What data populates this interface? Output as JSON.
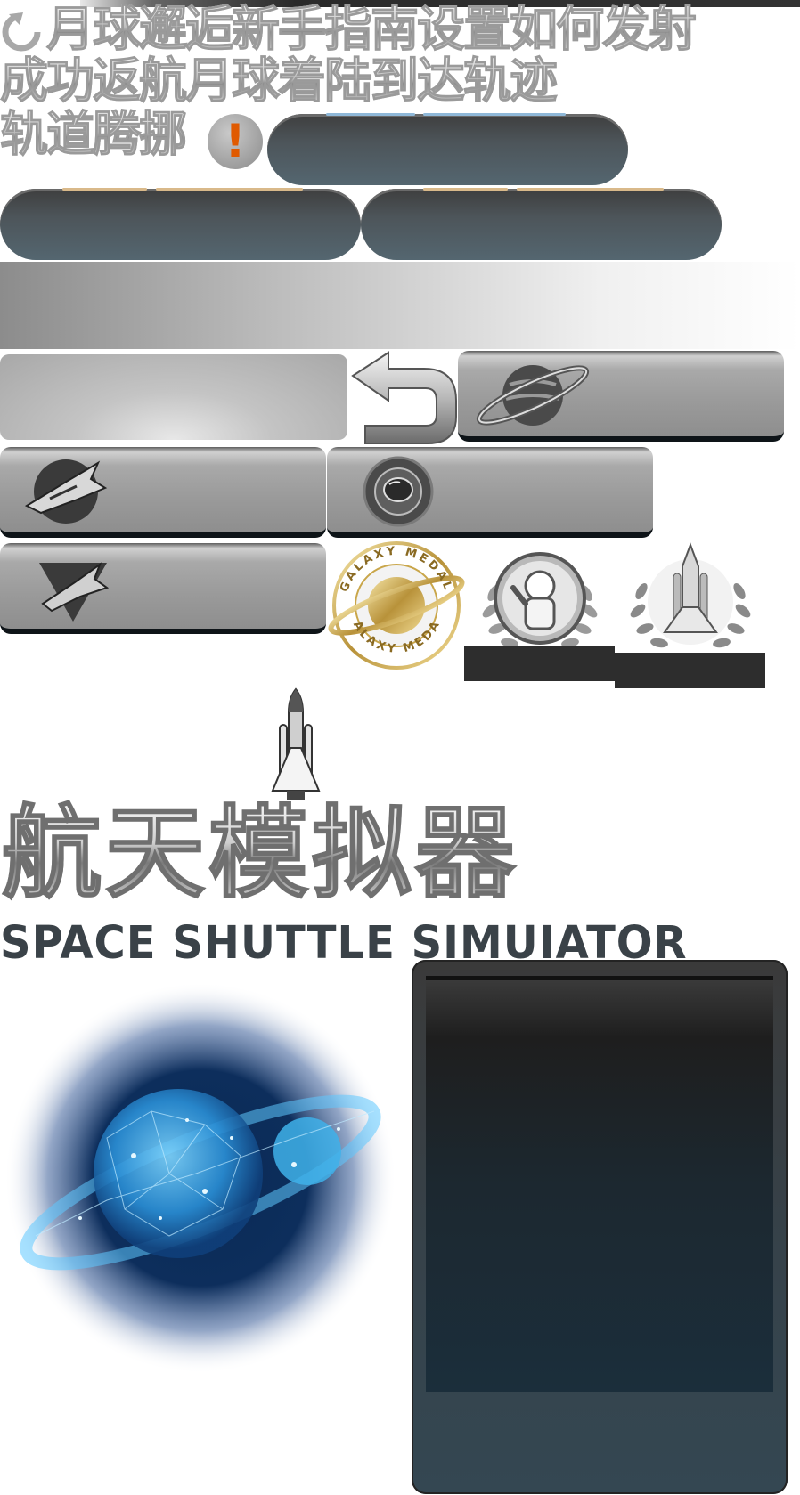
{
  "headline": {
    "line1": "月球邂逅新手指南设置如何发射",
    "line2": "成功返航月球着陆到达轨迹",
    "line3": "轨道腾挪"
  },
  "warning_badge": "!",
  "icons": {
    "reset": "reset-icon",
    "back": "back-arrow-icon",
    "planet": "ringed-planet-icon",
    "shuttle": "space-shuttle-icon",
    "astronaut": "astronaut-helmet-icon",
    "triangle_shuttle": "triangle-shuttle-icon",
    "rocket": "rocket-icon"
  },
  "medals": {
    "galaxy_top": "GALAXY MEDAL",
    "galaxy_bottom": "GALAXY MEDAL"
  },
  "title": {
    "cn": "航天模拟器",
    "en": "SPACE SHUTTLE SIMUIATOR"
  },
  "colors": {
    "pill": "#546670",
    "accent_orange": "#e05a00",
    "gold": "#c9a64a",
    "planet_blue": "#3aa8e8"
  }
}
